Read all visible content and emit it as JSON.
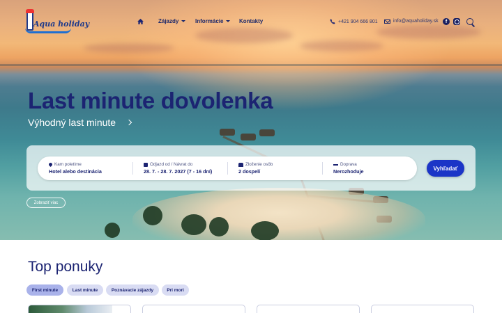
{
  "header": {
    "logo_text": "Aqua holiday",
    "nav": [
      {
        "label": "Zájazdy",
        "has_dropdown": true
      },
      {
        "label": "Informácie",
        "has_dropdown": true
      },
      {
        "label": "Kontakty",
        "has_dropdown": false
      }
    ],
    "phone": "+421 904 666 801",
    "email": "info@aquaholiday.sk",
    "social": [
      "facebook-icon",
      "instagram-icon"
    ]
  },
  "hero": {
    "title": "Last minute dovolenka",
    "subtitle": "Výhodný last minute"
  },
  "search": {
    "fields": [
      {
        "label": "Kam poletíme",
        "value": "Hotel alebo destinácia",
        "icon": "location-pin-icon"
      },
      {
        "label": "Odjazd od / Návrat do",
        "value": "28. 7. - 28. 7. 2027 (7 - 16 dní)",
        "icon": "calendar-icon"
      },
      {
        "label": "Zloženie osôb",
        "value": "2 dospelí",
        "icon": "people-icon"
      },
      {
        "label": "Doprava",
        "value": "Nerozhoduje",
        "icon": "plane-icon"
      }
    ],
    "button_label": "Vyhľadať",
    "more_label": "Zobraziť viac"
  },
  "top_offers": {
    "title": "Top ponuky",
    "tabs": [
      {
        "label": "First minute",
        "active": true
      },
      {
        "label": "Last minute",
        "active": false
      },
      {
        "label": "Poznávacie zájazdy",
        "active": false
      },
      {
        "label": "Pri mori",
        "active": false
      }
    ]
  },
  "colors": {
    "brand_navy": "#1c2472",
    "button_blue": "#1b35c7",
    "tag_red": "#e23b3b"
  }
}
